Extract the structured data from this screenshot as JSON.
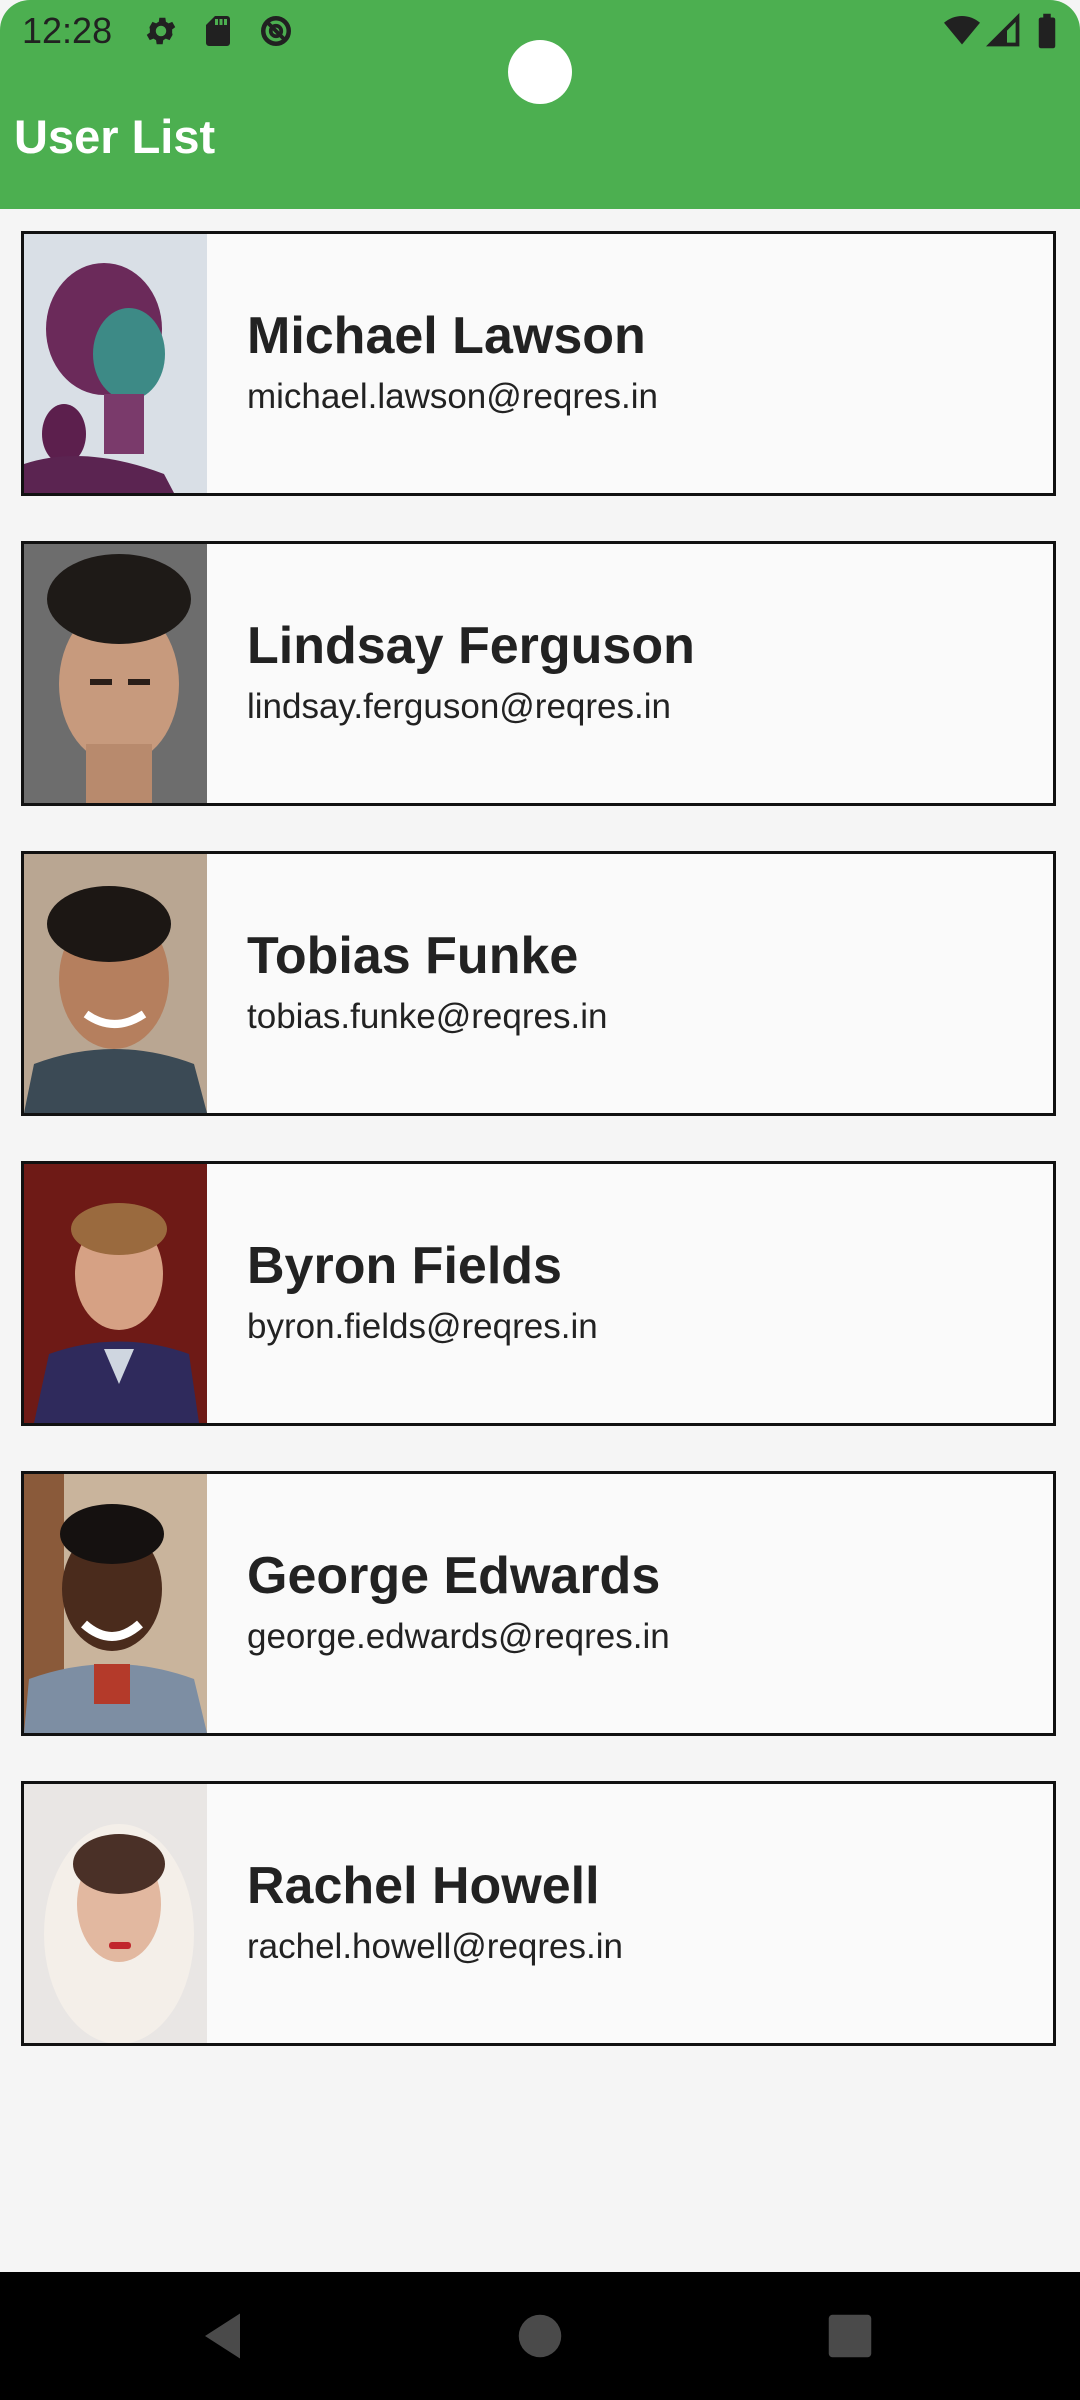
{
  "status_bar": {
    "time": "12:28",
    "left_icons": [
      "settings-icon",
      "sd-card-icon",
      "data-saver-icon"
    ],
    "right_icons": [
      "wifi-icon",
      "signal-icon",
      "battery-icon"
    ]
  },
  "app_bar": {
    "title": "User List",
    "color": "#4caf50"
  },
  "users": [
    {
      "name": "Michael Lawson",
      "email": "michael.lawson@reqres.in"
    },
    {
      "name": "Lindsay Ferguson",
      "email": "lindsay.ferguson@reqres.in"
    },
    {
      "name": "Tobias Funke",
      "email": "tobias.funke@reqres.in"
    },
    {
      "name": "Byron Fields",
      "email": "byron.fields@reqres.in"
    },
    {
      "name": "George Edwards",
      "email": "george.edwards@reqres.in"
    },
    {
      "name": "Rachel Howell",
      "email": "rachel.howell@reqres.in"
    }
  ],
  "nav_bar": {
    "buttons": [
      "back-icon",
      "home-icon",
      "recents-icon"
    ]
  }
}
